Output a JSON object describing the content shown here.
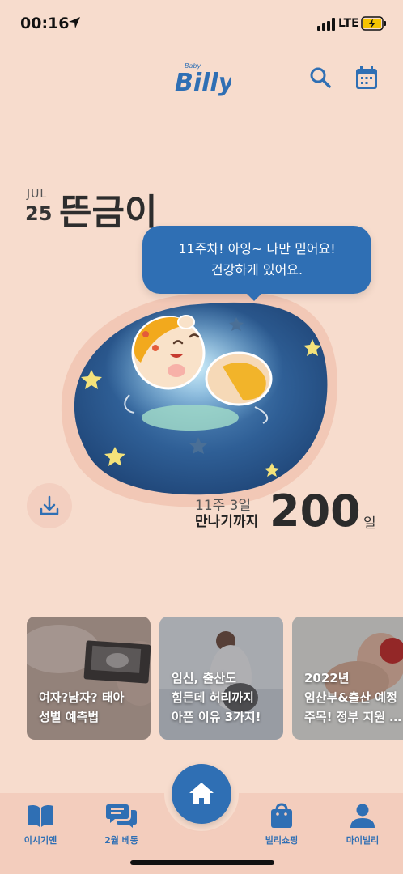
{
  "status_bar": {
    "time": "00:16",
    "network": "LTE"
  },
  "header": {
    "logo_small": "Baby",
    "logo_text": "Billy",
    "icons": [
      "search-icon",
      "calendar-icon"
    ]
  },
  "profile": {
    "month": "JUL",
    "day": "25",
    "nickname": "뜬금이"
  },
  "bubble": {
    "line1": "11주차! 아잉~ 나만 믿어요!",
    "line2": "건강하게 있어요."
  },
  "pregnancy": {
    "week_text": "11주 3일",
    "until_text": "만나기까지",
    "dday": "200",
    "dday_unit": "일"
  },
  "cards": [
    {
      "title": "여자?남자? 태아\n성별 예측법"
    },
    {
      "title": "임신, 출산도\n힘든데 허리까지\n아픈 이유 3가지!"
    },
    {
      "title": "2022년\n임산부&출산 예정\n주목! 정부 지원 …"
    }
  ],
  "tabs": [
    {
      "label": "이시기엔",
      "icon": "book-icon"
    },
    {
      "label": "2월 베동",
      "icon": "chat-icon"
    },
    {
      "label": "",
      "icon": "home-icon"
    },
    {
      "label": "빌리쇼핑",
      "icon": "shopping-bag-icon"
    },
    {
      "label": "마이빌리",
      "icon": "person-icon"
    }
  ],
  "colors": {
    "background": "#f7dccd",
    "accent": "#2f6fb4",
    "tabbar": "#f3cdbd"
  }
}
